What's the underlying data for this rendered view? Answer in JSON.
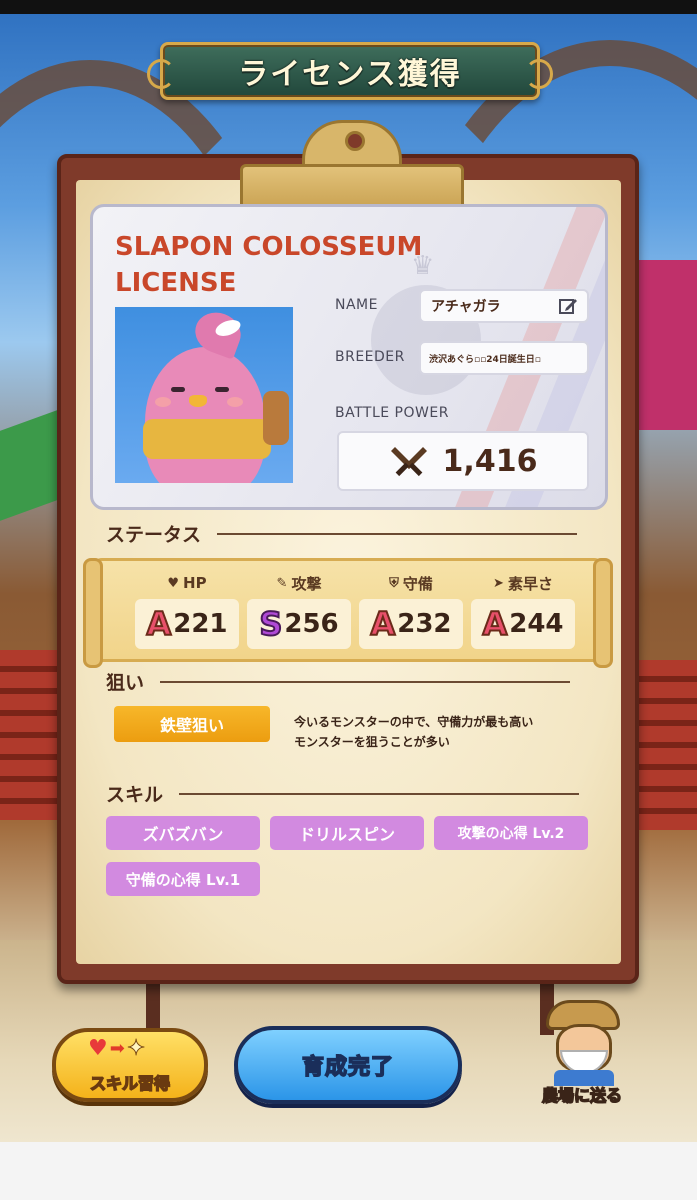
{
  "banner": {
    "title": "ライセンス獲得"
  },
  "license": {
    "title": "SLAPON COLOSSEUM LICENSE",
    "name_label": "NAME",
    "name_value": "アチャガラ",
    "breeder_label": "BREEDER",
    "breeder_value": "渋沢あぐら▫▫24日誕生日▫",
    "power_label": "BATTLE POWER",
    "power_value": "1,416"
  },
  "status": {
    "heading": "ステータス",
    "stats": [
      {
        "label": "HP",
        "icon": "heart-icon",
        "rank": "A",
        "value": "221"
      },
      {
        "label": "攻撃",
        "icon": "attack-icon",
        "rank": "S",
        "value": "256"
      },
      {
        "label": "守備",
        "icon": "shield-icon",
        "rank": "A",
        "value": "232"
      },
      {
        "label": "素早さ",
        "icon": "boot-icon",
        "rank": "A",
        "value": "244"
      }
    ]
  },
  "aim": {
    "heading": "狙い",
    "badge": "鉄壁狙い",
    "description_line1": "今いるモンスターの中で、守備力が最も高い",
    "description_line2": "モンスターを狙うことが多い"
  },
  "skills": {
    "heading": "スキル",
    "items": [
      "ズバズバン",
      "ドリルスピン",
      "攻撃の心得 Lv.2",
      "守備の心得 Lv.1"
    ]
  },
  "buttons": {
    "learn_skill": "スキル習得",
    "complete": "育成完了",
    "send_to_farm": "農場に送る"
  },
  "colors": {
    "skill_chip": "#d28ae0",
    "aim_badge": "#f7b72a",
    "rank_a": "#e8506a",
    "rank_s": "#b04ad6",
    "license_title": "#c9472a"
  }
}
